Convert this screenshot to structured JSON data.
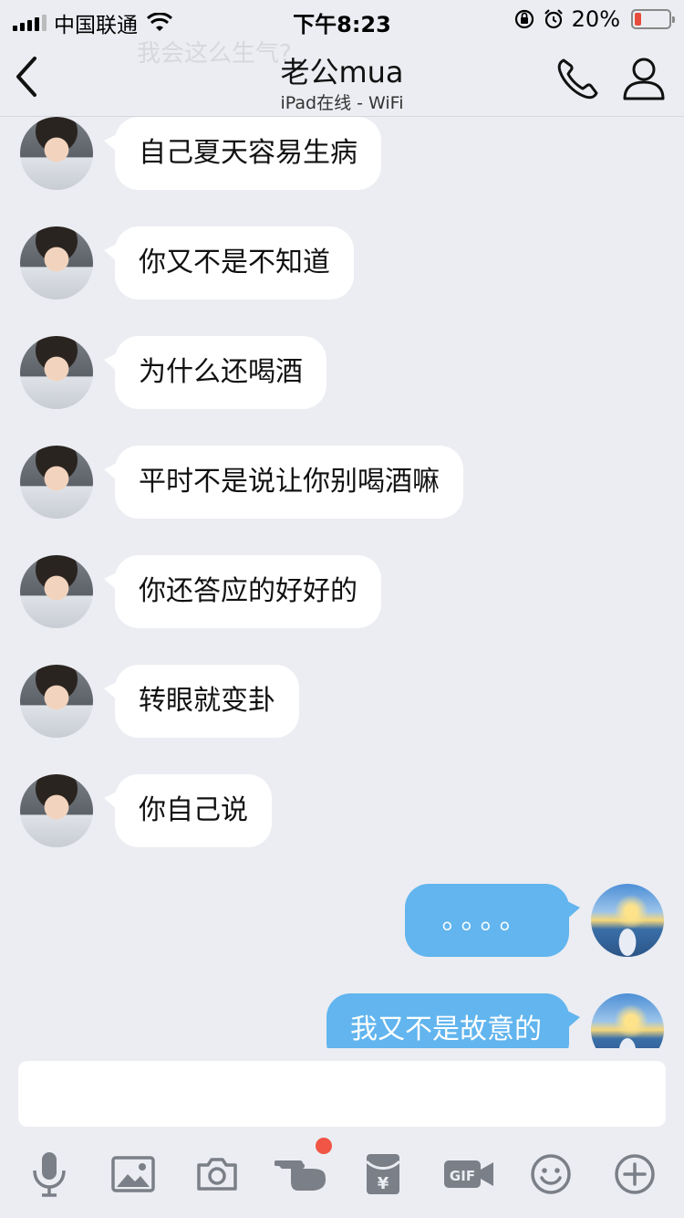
{
  "status_bar": {
    "carrier": "中国联通",
    "time": "下午8:23",
    "battery_percent": "20%",
    "battery_level": 0.2,
    "battery_color": "#e74c3c"
  },
  "nav": {
    "faded_preview": "我会这么生气?",
    "title": "老公mua",
    "subtitle": "iPad在线 - WiFi",
    "back_icon": "chevron-left-icon",
    "call_icon": "phone-icon",
    "profile_icon": "person-icon"
  },
  "messages": [
    {
      "side": "in",
      "text": "自己夏天容易生病"
    },
    {
      "side": "in",
      "text": "你又不是不知道"
    },
    {
      "side": "in",
      "text": "为什么还喝酒"
    },
    {
      "side": "in",
      "text": "平时不是说让你别喝酒嘛"
    },
    {
      "side": "in",
      "text": "你还答应的好好的"
    },
    {
      "side": "in",
      "text": "转眼就变卦"
    },
    {
      "side": "in",
      "text": "你自己说"
    },
    {
      "side": "out",
      "text": "。。。。"
    },
    {
      "side": "out",
      "text": "我又不是故意的"
    }
  ],
  "input": {
    "value": "",
    "placeholder": ""
  },
  "toolbar": {
    "items": [
      {
        "icon": "microphone-icon"
      },
      {
        "icon": "image-icon"
      },
      {
        "icon": "camera-icon"
      },
      {
        "icon": "poke-hand-icon",
        "has_notification_dot": true
      },
      {
        "icon": "red-packet-icon"
      },
      {
        "icon": "gif-icon"
      },
      {
        "icon": "emoji-icon"
      },
      {
        "icon": "plus-icon"
      }
    ],
    "icon_color": "#7b7f88",
    "dot_color": "#f05545"
  },
  "colors": {
    "background": "#ebedf2",
    "incoming_bubble": "#ffffff",
    "outgoing_bubble": "#62b5ee"
  }
}
